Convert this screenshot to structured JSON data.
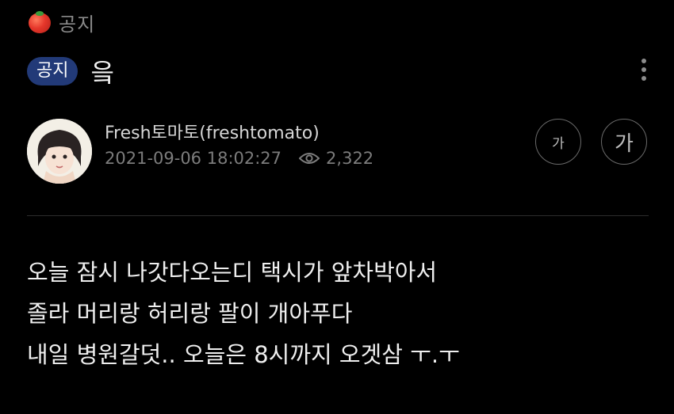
{
  "board": {
    "icon": "tomato-icon",
    "name": "공지"
  },
  "post": {
    "badge": "공지",
    "title": "읔"
  },
  "author": {
    "name": "Fresh토마토(freshtomato)",
    "datetime": "2021-09-06 18:02:27",
    "views": "2,322"
  },
  "font_controls": {
    "small_label": "가",
    "large_label": "가"
  },
  "body": {
    "lines": [
      "오늘 잠시 나갓다오는디 택시가 앞차박아서",
      "졸라 머리랑 허리랑 팔이 개아푸다",
      "내일 병원갈덧.. 오늘은 8시까지 오겟삼 ㅜ.ㅜ"
    ]
  },
  "colors": {
    "background": "#000000",
    "badge": "#223a78",
    "text": "#efefef",
    "muted": "#7c7c7c"
  }
}
